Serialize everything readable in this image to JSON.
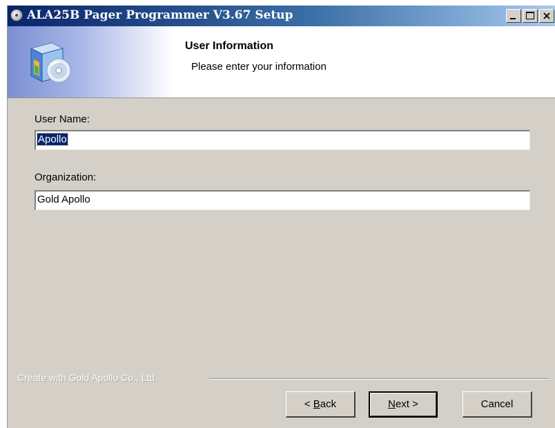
{
  "window": {
    "title": "ALA25B Pager Programmer V3.67 Setup",
    "icon": "cd-icon"
  },
  "header": {
    "title": "User Information",
    "subtitle": "Please enter your information",
    "icon": "setup-box-icon"
  },
  "form": {
    "user_name_label": "User Name:",
    "user_name_value": "Apollo",
    "organization_label": "Organization:",
    "organization_value": "Gold Apollo"
  },
  "footer": {
    "brand_text": "Create with Gold Apollo Co., Ltd.",
    "back_label_underlined": "B",
    "back_prefix": "< ",
    "back_suffix": "ack",
    "next_label_underlined": "N",
    "next_suffix": "ext >",
    "cancel_label": "Cancel"
  },
  "colors": {
    "titlebar_start": "#0a246a",
    "titlebar_end": "#a6caf0",
    "selection": "#0a246a",
    "dialog_bg": "#d4d0c8"
  }
}
